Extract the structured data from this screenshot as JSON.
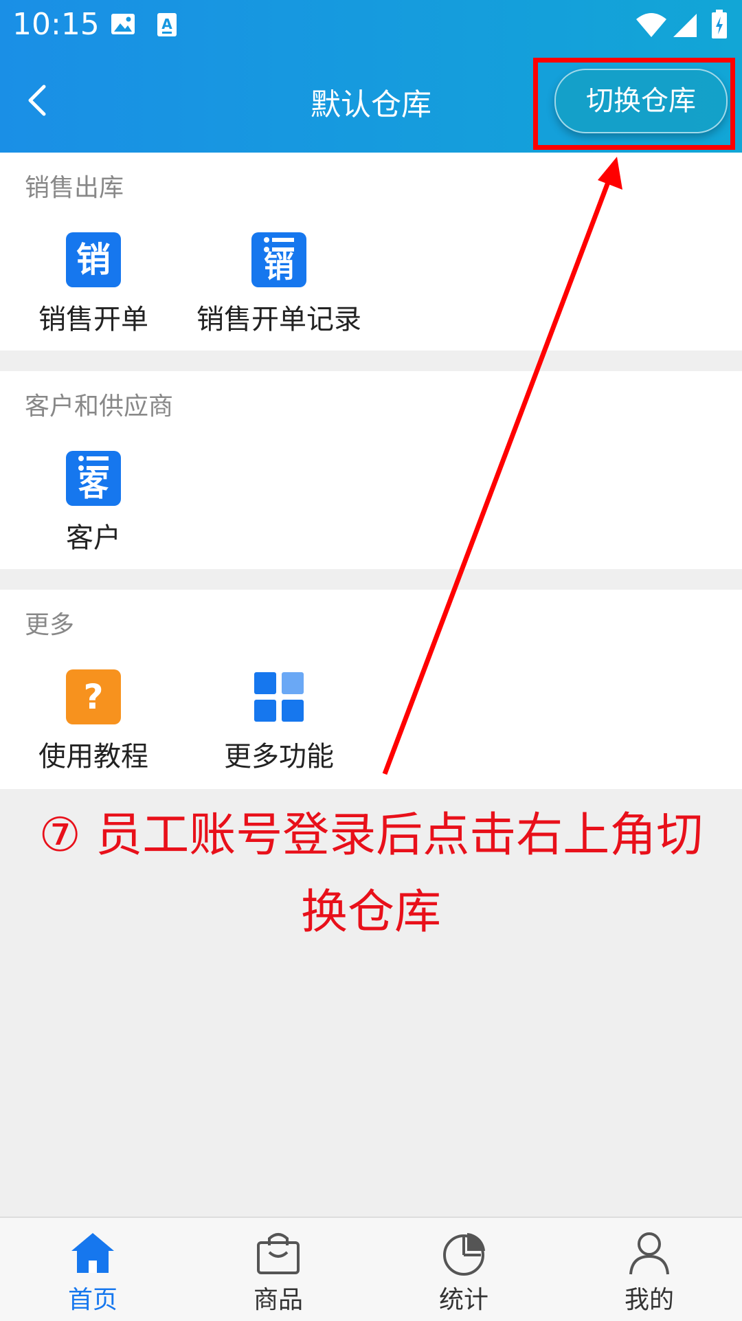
{
  "status_bar": {
    "time": "10:15"
  },
  "header": {
    "title": "默认仓库",
    "switch_label": "切换仓库"
  },
  "sections": [
    {
      "title": "销售出库",
      "items": [
        {
          "icon_char": "销",
          "label": "销售开单"
        },
        {
          "icon_char": "销",
          "label": "销售开单记录"
        }
      ]
    },
    {
      "title": "客户和供应商",
      "items": [
        {
          "icon_char": "客",
          "label": "客户"
        }
      ]
    },
    {
      "title": "更多",
      "items": [
        {
          "icon_char": "?",
          "label": "使用教程"
        },
        {
          "icon_char": "",
          "label": "更多功能"
        }
      ]
    }
  ],
  "annotation": {
    "marker": "⑦",
    "text": "员工账号登录后点击右上角切换仓库"
  },
  "tabs": [
    {
      "label": "首页",
      "icon": "home-icon",
      "active": true
    },
    {
      "label": "商品",
      "icon": "shopping-bag-icon",
      "active": false
    },
    {
      "label": "统计",
      "icon": "pie-chart-icon",
      "active": false
    },
    {
      "label": "我的",
      "icon": "user-icon",
      "active": false
    }
  ],
  "colors": {
    "accent": "#1677ee",
    "header_start": "#1a8fe6",
    "header_end": "#12a6d6",
    "annotation": "#e8101a",
    "orange": "#f7921e"
  }
}
